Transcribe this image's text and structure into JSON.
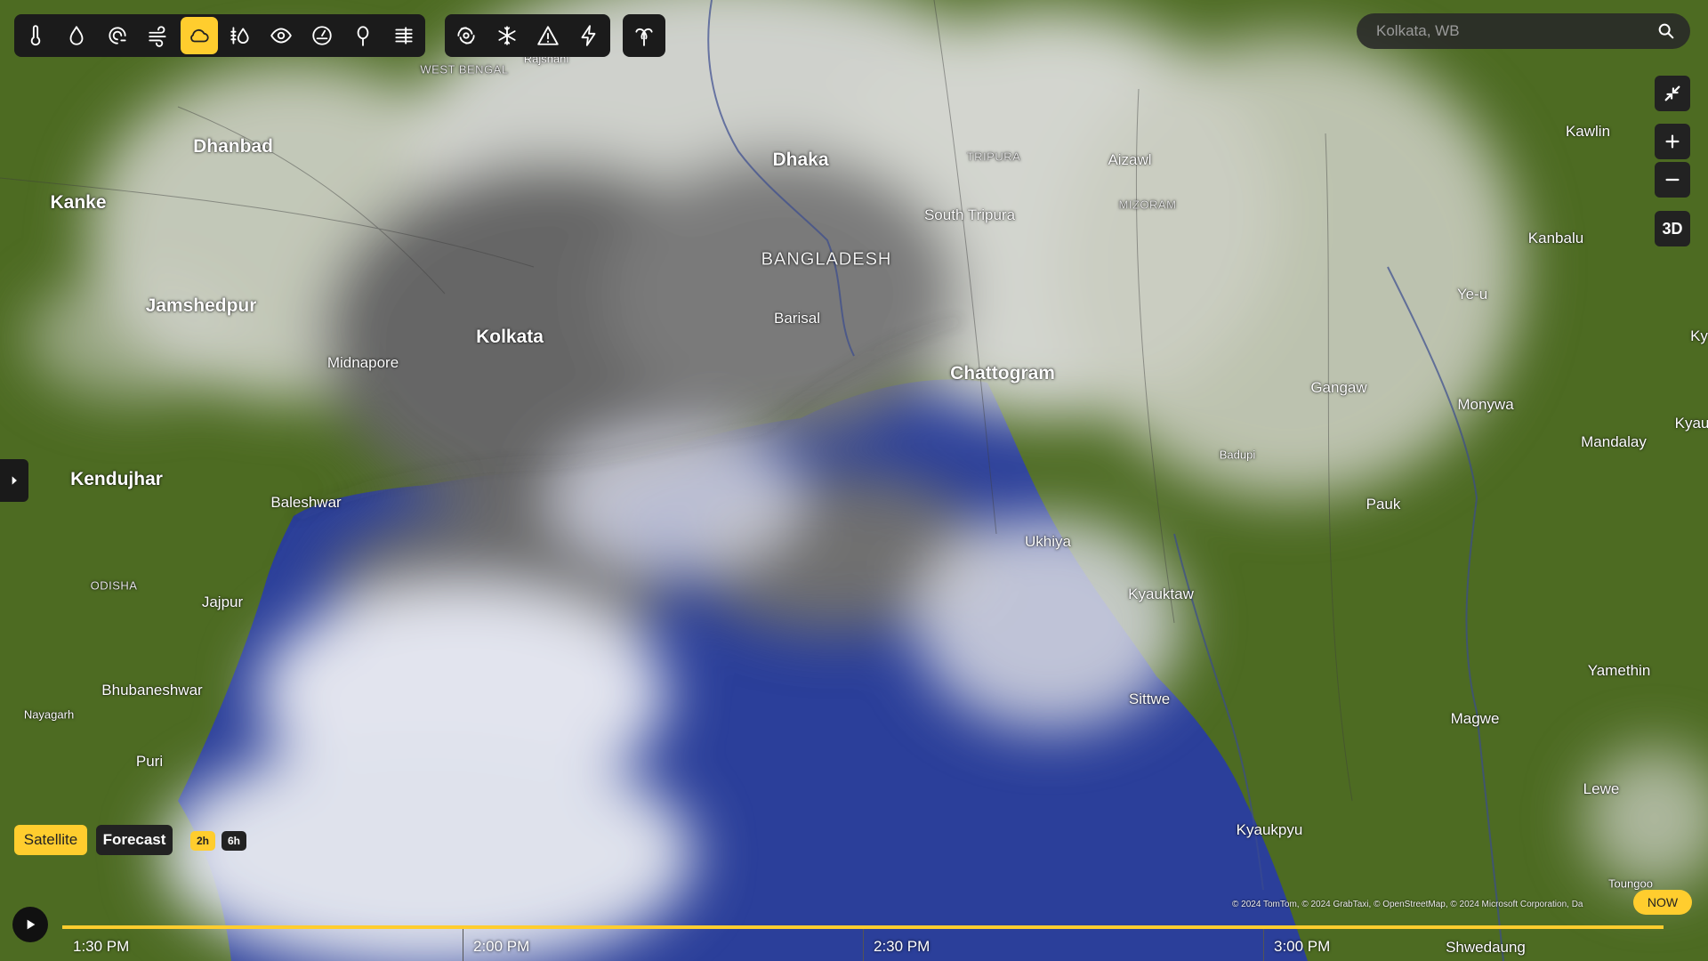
{
  "search": {
    "placeholder": "Kolkata, WB"
  },
  "toolbar_layers": [
    {
      "name": "temperature-icon"
    },
    {
      "name": "precipitation-icon"
    },
    {
      "name": "wind-gust-icon"
    },
    {
      "name": "wind-icon"
    },
    {
      "name": "cloud-icon",
      "active": true
    },
    {
      "name": "humidity-icon"
    },
    {
      "name": "visibility-icon"
    },
    {
      "name": "pressure-icon"
    },
    {
      "name": "pollen-icon"
    },
    {
      "name": "air-quality-icon"
    }
  ],
  "toolbar_events": [
    {
      "name": "hurricane-icon"
    },
    {
      "name": "snowflake-icon"
    },
    {
      "name": "warning-icon"
    },
    {
      "name": "lightning-icon"
    }
  ],
  "toolbar_extra": [
    {
      "name": "tropical-icon"
    }
  ],
  "controls": {
    "three_d": "3D"
  },
  "modes": {
    "satellite": "Satellite",
    "forecast": "Forecast",
    "chip_2h": "2h",
    "chip_6h": "6h"
  },
  "timeline": {
    "labels": [
      "1:30 PM",
      "2:00 PM",
      "2:30 PM",
      "3:00 PM"
    ],
    "now": "NOW"
  },
  "attribution": "© 2024 TomTom, © 2024 GrabTaxi, © OpenStreetMap, © 2024 Microsoft Corporation, Da",
  "colors": {
    "accent": "#ffcd2e",
    "sea": "#2b3f9a",
    "land": "#4d6b22",
    "cloud": "#d8dad6"
  },
  "map_labels": {
    "rajshahi": "Rajshahi",
    "west_bengal": "WEST BENGAL",
    "dhanbad": "Dhanbad",
    "kanke": "Kanke",
    "jamshedpur": "Jamshedpur",
    "midnapore": "Midnapore",
    "kolkata": "Kolkata",
    "kendujhar": "Kendujhar",
    "baleshwar": "Baleshwar",
    "odisha": "ODISHA",
    "jajpur": "Jajpur",
    "bhubaneshwar": "Bhubaneshwar",
    "nayagarh": "Nayagarh",
    "puri": "Puri",
    "dhaka": "Dhaka",
    "bangladesh": "BANGLADESH",
    "barisal": "Barisal",
    "tripura": "TRIPURA",
    "south_tripura": "South Tripura",
    "chattogram": "Chattogram",
    "aizawl": "Aizawl",
    "mizoram": "MIZORAM",
    "ukhiya": "Ukhiya",
    "kyauktaw": "Kyauktaw",
    "sittwe": "Sittwe",
    "kyaukpyu": "Kyaukpyu",
    "badupi": "Badupi",
    "gangaw": "Gangaw",
    "pauk": "Pauk",
    "kawlin": "Kawlin",
    "kanbalu": "Kanbalu",
    "ye_u": "Ye-u",
    "monywa": "Monywa",
    "mandalay": "Mandalay",
    "yamethin": "Yamethin",
    "magwe": "Magwe",
    "lewe": "Lewe",
    "toungoo": "Toungoo",
    "shwedaung": "Shwedaung",
    "ky_edge": "Ky",
    "kyau_edge": "Kyau"
  }
}
